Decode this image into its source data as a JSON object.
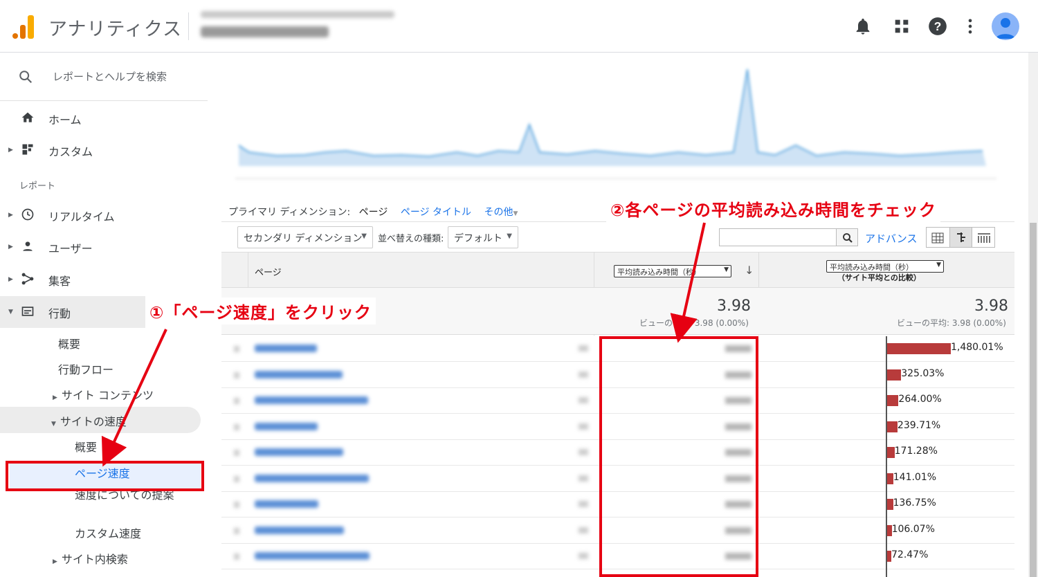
{
  "header": {
    "app_title": "アナリティクス",
    "icons": [
      "bell-icon",
      "apps-grid-icon",
      "help-icon",
      "more-vert-icon",
      "account-avatar"
    ]
  },
  "sidebar": {
    "search_placeholder": "レポートとヘルプを検索",
    "home": "ホーム",
    "custom": "カスタム",
    "section_reports": "レポート",
    "realtime": "リアルタイム",
    "users": "ユーザー",
    "acquisition": "集客",
    "behavior": "行動",
    "behavior_sub": {
      "overview": "概要",
      "flow": "行動フロー",
      "site_content": "サイト コンテンツ",
      "site_speed": "サイトの速度",
      "speed_sub": {
        "overview": "概要",
        "page_speed": "ページ速度",
        "suggestions": "速度についての提案",
        "custom_speed": "カスタム速度"
      },
      "site_search": "サイト内検索"
    }
  },
  "report": {
    "primary_dimension_label": "プライマリ ディメンション:",
    "dimension_page": "ページ",
    "dimension_page_title": "ページ タイトル",
    "dimension_other": "その他",
    "secondary_dimension": "セカンダリ ディメンション",
    "sort_type_label": "並べ替えの種類:",
    "sort_default": "デフォルト",
    "advanced": "アドバンス",
    "col_page": "ページ",
    "col_metric": "平均読み込み時間（秒）",
    "col_compare": "平均読み込み時間（秒）",
    "col_compare_sub": "（サイト平均との比較）",
    "total_value": "3.98",
    "total_sub": "ビューの平均: 3.98 (0.00%)",
    "total_value_2": "3.98",
    "total_sub_2": "ビューの平均: 3.98 (0.00%)"
  },
  "compare_rows": [
    {
      "pct": "1,480.01%",
      "value": 14.8
    },
    {
      "pct": "325.03%",
      "value": 3.25
    },
    {
      "pct": "264.00%",
      "value": 2.64
    },
    {
      "pct": "239.71%",
      "value": 2.4
    },
    {
      "pct": "171.28%",
      "value": 1.71
    },
    {
      "pct": "141.01%",
      "value": 1.41
    },
    {
      "pct": "136.75%",
      "value": 1.37
    },
    {
      "pct": "106.07%",
      "value": 1.06
    },
    {
      "pct": "72.47%",
      "value": 0.72
    }
  ],
  "annotations": {
    "step1": "①「ページ速度」をクリック",
    "step2": "②各ページの平均読み込み時間をチェック",
    "color": "#e60012"
  }
}
